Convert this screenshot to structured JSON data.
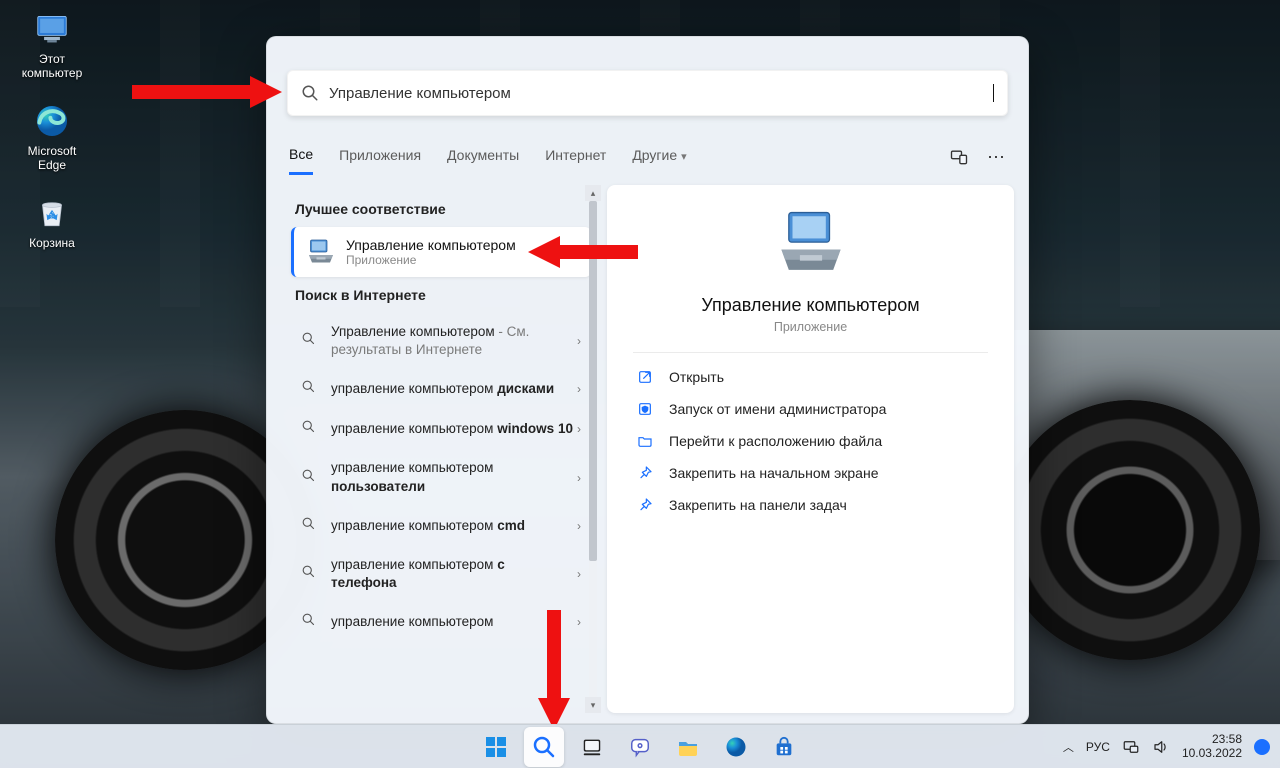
{
  "desktop": {
    "icons": [
      {
        "name": "this-pc",
        "label": "Этот компьютер"
      },
      {
        "name": "edge",
        "label": "Microsoft Edge"
      },
      {
        "name": "recycle",
        "label": "Корзина"
      }
    ]
  },
  "search": {
    "query": "Управление компьютером",
    "tabs": {
      "all": "Все",
      "apps": "Приложения",
      "docs": "Документы",
      "web": "Интернет",
      "more": "Другие"
    },
    "best_match_header": "Лучшее соответствие",
    "best_match": {
      "title": "Управление компьютером",
      "subtitle": "Приложение"
    },
    "web_header": "Поиск в Интернете",
    "web_results": [
      {
        "pre": "Управление компьютером",
        "post": " - См. результаты в Интернете"
      },
      {
        "pre": "управление компьютером ",
        "bold": "дисками"
      },
      {
        "pre": "управление компьютером ",
        "bold": "windows 10"
      },
      {
        "pre": "управление компьютером ",
        "bold": "пользователи"
      },
      {
        "pre": "управление компьютером ",
        "bold": "cmd"
      },
      {
        "pre": "управление компьютером ",
        "bold": "с телефона"
      },
      {
        "pre": "управление компьютером "
      }
    ]
  },
  "details": {
    "title": "Управление компьютером",
    "subtitle": "Приложение",
    "actions": [
      {
        "icon": "open",
        "label": "Открыть"
      },
      {
        "icon": "admin",
        "label": "Запуск от имени администратора"
      },
      {
        "icon": "folder",
        "label": "Перейти к расположению файла"
      },
      {
        "icon": "pin-start",
        "label": "Закрепить на начальном экране"
      },
      {
        "icon": "pin-tb",
        "label": "Закрепить на панели задач"
      }
    ]
  },
  "taskbar": {
    "lang": "РУС",
    "time": "23:58",
    "date": "10.03.2022"
  }
}
